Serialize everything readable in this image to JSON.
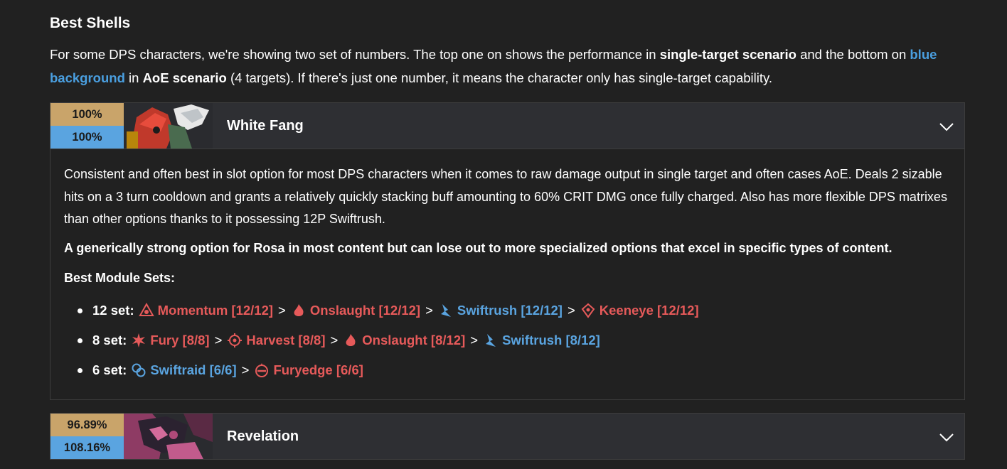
{
  "section": {
    "title": "Best Shells",
    "intro": {
      "p1": "For some DPS characters, we're showing two set of numbers. The top one on shows the performance in ",
      "p1_bold": "single-target scenario",
      "p2": " and the bottom on ",
      "p2_blue": "blue background",
      "p3": " in ",
      "p3_bold": "AoE scenario",
      "p4": " (4 targets). If there's just one number, it means the character only has single-target capability."
    }
  },
  "shells": [
    {
      "single_score": "100%",
      "aoe_score": "100%",
      "name": "White Fang",
      "description": "Consistent and often best in slot option for most DPS characters when it comes to raw damage output in single target and often cases AoE. Deals 2 sizable hits on a 3 turn cooldown and grants a relatively quickly stacking buff amounting to 60% CRIT DMG once fully charged. Also has more flexible DPS matrixes than other options thanks to it possessing 12P Swiftrush.",
      "note": "A generically strong option for Rosa in most content but can lose out to more specialized options that excel in specific types of content.",
      "modules_label": "Best Module Sets:",
      "sets": [
        {
          "label": "12 set:",
          "modules": [
            {
              "name": "Momentum [12/12]",
              "color": "red",
              "icon": "momentum-icon"
            },
            {
              "name": "Onslaught [12/12]",
              "color": "red",
              "icon": "onslaught-icon"
            },
            {
              "name": "Swiftrush [12/12]",
              "color": "blue",
              "icon": "swiftrush-icon"
            },
            {
              "name": "Keeneye [12/12]",
              "color": "red",
              "icon": "keeneye-icon"
            }
          ]
        },
        {
          "label": "8 set:",
          "modules": [
            {
              "name": "Fury [8/8]",
              "color": "red",
              "icon": "fury-icon"
            },
            {
              "name": "Harvest [8/8]",
              "color": "red",
              "icon": "harvest-icon"
            },
            {
              "name": "Onslaught [8/12]",
              "color": "red",
              "icon": "onslaught-icon"
            },
            {
              "name": "Swiftrush [8/12]",
              "color": "blue",
              "icon": "swiftrush-icon"
            }
          ]
        },
        {
          "label": "6 set:",
          "modules": [
            {
              "name": "Swiftraid [6/6]",
              "color": "blue",
              "icon": "swiftraid-icon"
            },
            {
              "name": "Furyedge [6/6]",
              "color": "red",
              "icon": "furyedge-icon"
            }
          ]
        }
      ],
      "separator": ">"
    },
    {
      "single_score": "96.89%",
      "aoe_score": "108.16%",
      "name": "Revelation"
    }
  ],
  "colors": {
    "single_bg": "#c9a46a",
    "aoe_bg": "#5aa4e0",
    "red_text": "#e65a5a",
    "blue_text": "#5aa4e0"
  }
}
